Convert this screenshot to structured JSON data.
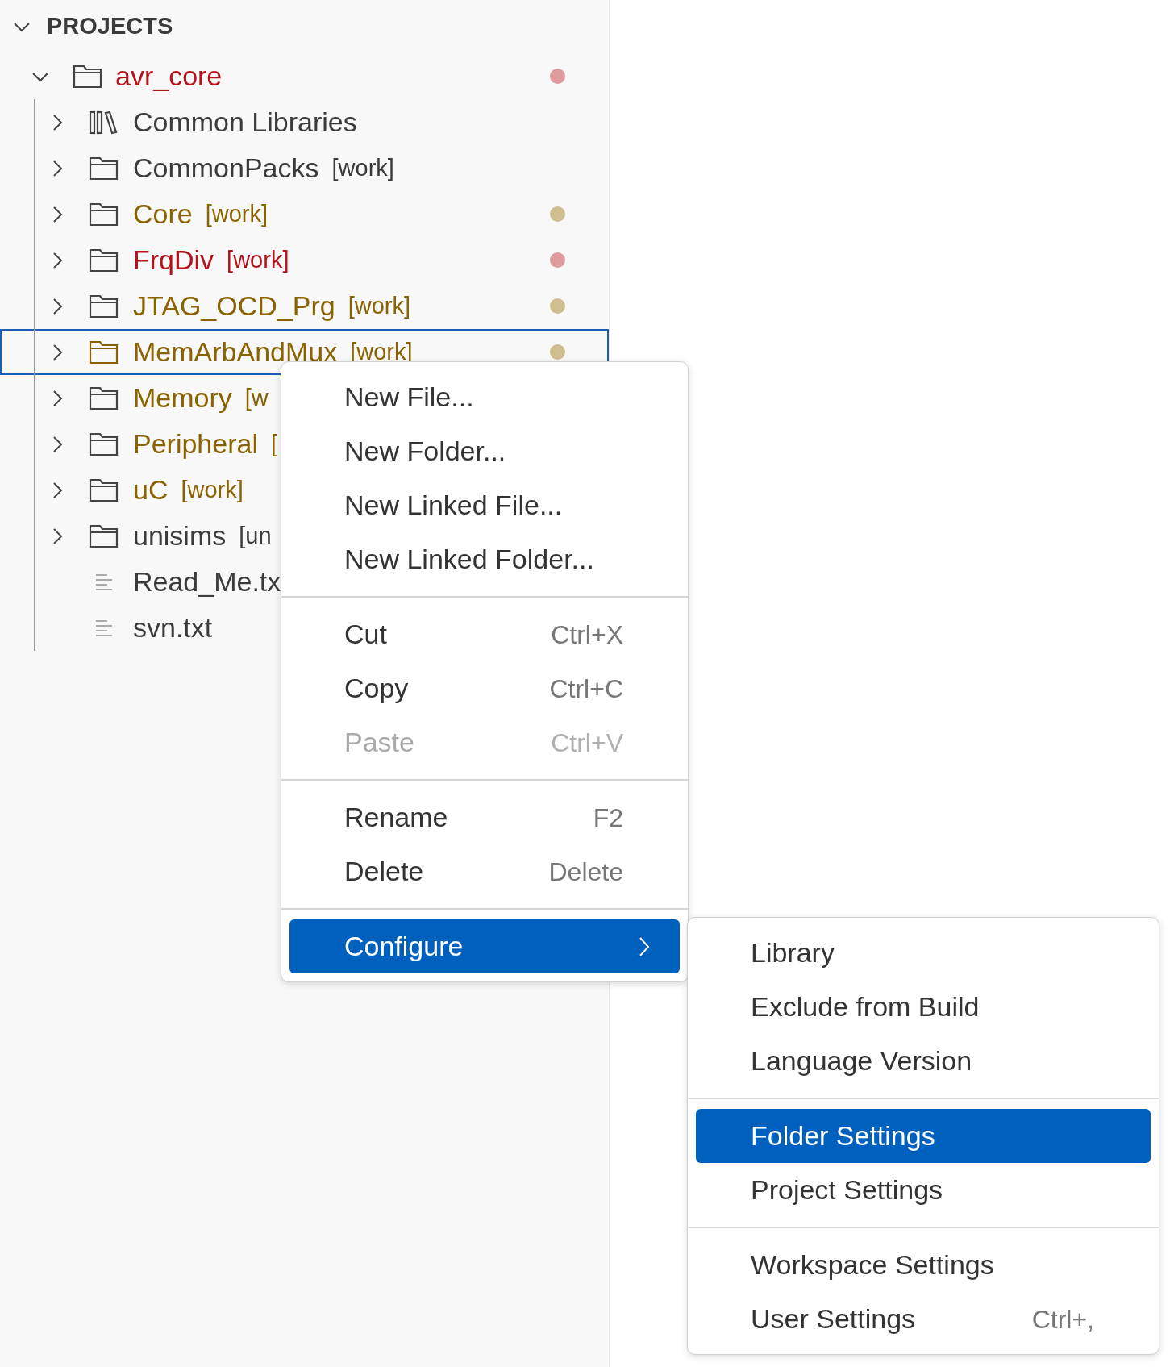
{
  "explorer": {
    "section": {
      "title": "PROJECTS",
      "expanded": true
    },
    "project": {
      "label": "avr_core",
      "error": true,
      "color": "#de9a9e",
      "expanded": true,
      "children": [
        {
          "kind": "library",
          "label": "Common Libraries",
          "error": false,
          "modified": false,
          "expanded": false,
          "selected": false
        },
        {
          "kind": "folder",
          "label": "CommonPacks",
          "tag": "[work]",
          "error": false,
          "modified": false,
          "expanded": false,
          "selected": false
        },
        {
          "kind": "folder",
          "label": "Core",
          "tag": "[work]",
          "error": false,
          "modified": true,
          "color": "#cfbe90",
          "expanded": false,
          "selected": false
        },
        {
          "kind": "folder",
          "label": "FrqDiv",
          "tag": "[work]",
          "error": true,
          "color": "#de9a9e",
          "expanded": false,
          "selected": false
        },
        {
          "kind": "folder",
          "label": "JTAG_OCD_Prg",
          "tag": "[work]",
          "error": false,
          "modified": true,
          "color": "#cfbe90",
          "expanded": false,
          "selected": false
        },
        {
          "kind": "folder",
          "label": "MemArbAndMux",
          "tag": "[work]",
          "error": false,
          "modified": true,
          "color": "#cfbe90",
          "expanded": false,
          "selected": true
        },
        {
          "kind": "folder",
          "label": "Memory",
          "tag": "[w",
          "error": false,
          "modified": true,
          "expanded": false,
          "selected": false
        },
        {
          "kind": "folder",
          "label": "Peripheral",
          "tag": "[",
          "error": false,
          "modified": true,
          "expanded": false,
          "selected": false
        },
        {
          "kind": "folder",
          "label": "uC",
          "tag": "[work]",
          "error": false,
          "modified": true,
          "expanded": false,
          "selected": false
        },
        {
          "kind": "folder",
          "label": "unisims",
          "tag": "[un",
          "error": false,
          "modified": false,
          "expanded": false,
          "selected": false
        },
        {
          "kind": "file",
          "label": "Read_Me.tx",
          "error": false,
          "modified": false,
          "selected": false
        },
        {
          "kind": "file",
          "label": "svn.txt",
          "error": false,
          "modified": false,
          "selected": false
        }
      ]
    }
  },
  "context_menu": {
    "groups": [
      [
        {
          "label": "New File...",
          "disabled": false,
          "selected": false
        },
        {
          "label": "New Folder...",
          "disabled": false,
          "selected": false
        },
        {
          "label": "New Linked File...",
          "disabled": false,
          "selected": false
        },
        {
          "label": "New Linked Folder...",
          "disabled": false,
          "selected": false
        }
      ],
      [
        {
          "label": "Cut",
          "shortcut": "Ctrl+X",
          "disabled": false,
          "selected": false
        },
        {
          "label": "Copy",
          "shortcut": "Ctrl+C",
          "disabled": false,
          "selected": false
        },
        {
          "label": "Paste",
          "shortcut": "Ctrl+V",
          "disabled": true,
          "selected": false
        }
      ],
      [
        {
          "label": "Rename",
          "shortcut": "F2",
          "disabled": false,
          "selected": false
        },
        {
          "label": "Delete",
          "shortcut": "Delete",
          "disabled": false,
          "selected": false
        }
      ],
      [
        {
          "label": "Configure",
          "submenu": true,
          "disabled": false,
          "selected": true
        }
      ]
    ]
  },
  "submenu": {
    "groups": [
      [
        {
          "label": "Library",
          "disabled": false,
          "selected": false
        },
        {
          "label": "Exclude from Build",
          "disabled": false,
          "selected": false
        },
        {
          "label": "Language Version",
          "disabled": false,
          "selected": false
        }
      ],
      [
        {
          "label": "Folder Settings",
          "disabled": false,
          "selected": true
        },
        {
          "label": "Project Settings",
          "disabled": false,
          "selected": false
        }
      ],
      [
        {
          "label": "Workspace Settings",
          "disabled": false,
          "selected": false
        },
        {
          "label": "User Settings",
          "shortcut": "Ctrl+,",
          "disabled": false,
          "selected": false
        }
      ]
    ]
  }
}
